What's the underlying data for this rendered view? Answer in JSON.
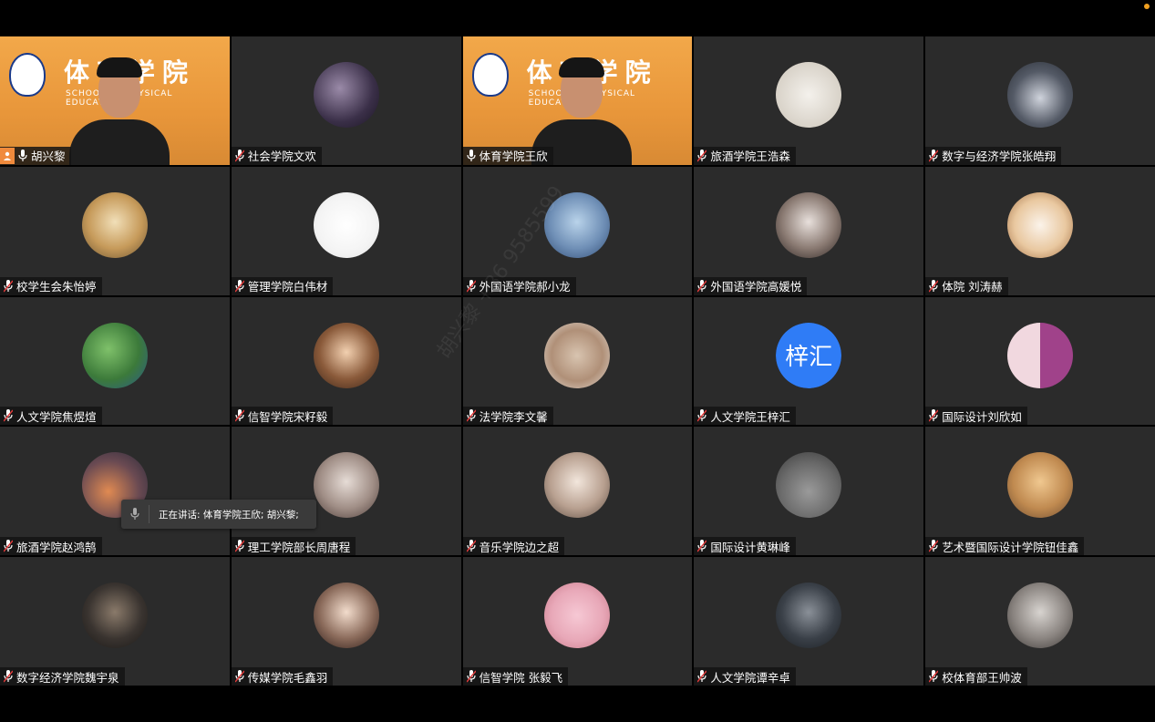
{
  "tiles": [
    {
      "name": "胡兴黎",
      "video": "school-banner",
      "host": true
    },
    {
      "name": "社会学院文欢",
      "avatar": "dark-anime-avatar"
    },
    {
      "name": "体育学院王欣",
      "video": "school-banner",
      "active": true
    },
    {
      "name": "旅酒学院王浩森",
      "avatar": "bear-toys-avatar"
    },
    {
      "name": "数字与经济学院张皓翔",
      "avatar": "hooded-anime-avatar"
    },
    {
      "name": "校学生会朱怡婷",
      "avatar": "dog-avatar"
    },
    {
      "name": "管理学院白伟材",
      "avatar": "cartoon-shark-avatar"
    },
    {
      "name": "外国语学院郝小龙",
      "avatar": "cartoon-mouse-avatar"
    },
    {
      "name": "外国语学院高媛悦",
      "avatar": "girl-photo-avatar"
    },
    {
      "name": "体院 刘涛赫",
      "avatar": "bear-hood-avatar"
    },
    {
      "name": "人文学院焦煜煊",
      "avatar": "palm-tree-avatar"
    },
    {
      "name": "信智学院宋籽毅",
      "avatar": "child-photo-avatar"
    },
    {
      "name": "法学院李文馨",
      "avatar": "teddy-bear-avatar"
    },
    {
      "name": "人文学院王梓汇",
      "avatar_text": "梓汇",
      "avatar_color": "#2f7cf6"
    },
    {
      "name": "国际设计刘欣如",
      "avatar": "pink-abstract-avatar"
    },
    {
      "name": "旅酒学院赵鸿鹄",
      "avatar": "sunset-silhouette-avatar"
    },
    {
      "name": "理工学院部长周唐程",
      "avatar": "couple-photo-avatar"
    },
    {
      "name": "音乐学院边之超",
      "avatar": "mirror-selfie-avatar"
    },
    {
      "name": "国际设计黄琳峰",
      "avatar": "penguin-toy-avatar"
    },
    {
      "name": "艺术暨国际设计学院钮佳鑫",
      "avatar": "cat-photo-avatar"
    },
    {
      "name": "数字经济学院魏宇泉",
      "avatar": "basketball-player-avatar"
    },
    {
      "name": "传媒学院毛鑫羽",
      "avatar": "girl-face-avatar"
    },
    {
      "name": "信智学院 张毅飞",
      "avatar": "pink-cartoon-avatar"
    },
    {
      "name": "人文学院谭辛卓",
      "avatar": "hooded-person-avatar"
    },
    {
      "name": "校体育部王帅波",
      "avatar": "man-with-cat-avatar"
    }
  ],
  "banner": {
    "title": "体育学院",
    "subtitle": "SCHOOL OF PHYSICAL EDUCATION"
  },
  "tooltip": {
    "label": "正在讲话: 体育学院王欣; 胡兴黎;"
  },
  "watermark": "胡兴黎 +86 9585599",
  "colors": {
    "active_border": "#3ec93e",
    "host_badge": "#f08a3c",
    "tile_bg": "#2b2b2b"
  }
}
